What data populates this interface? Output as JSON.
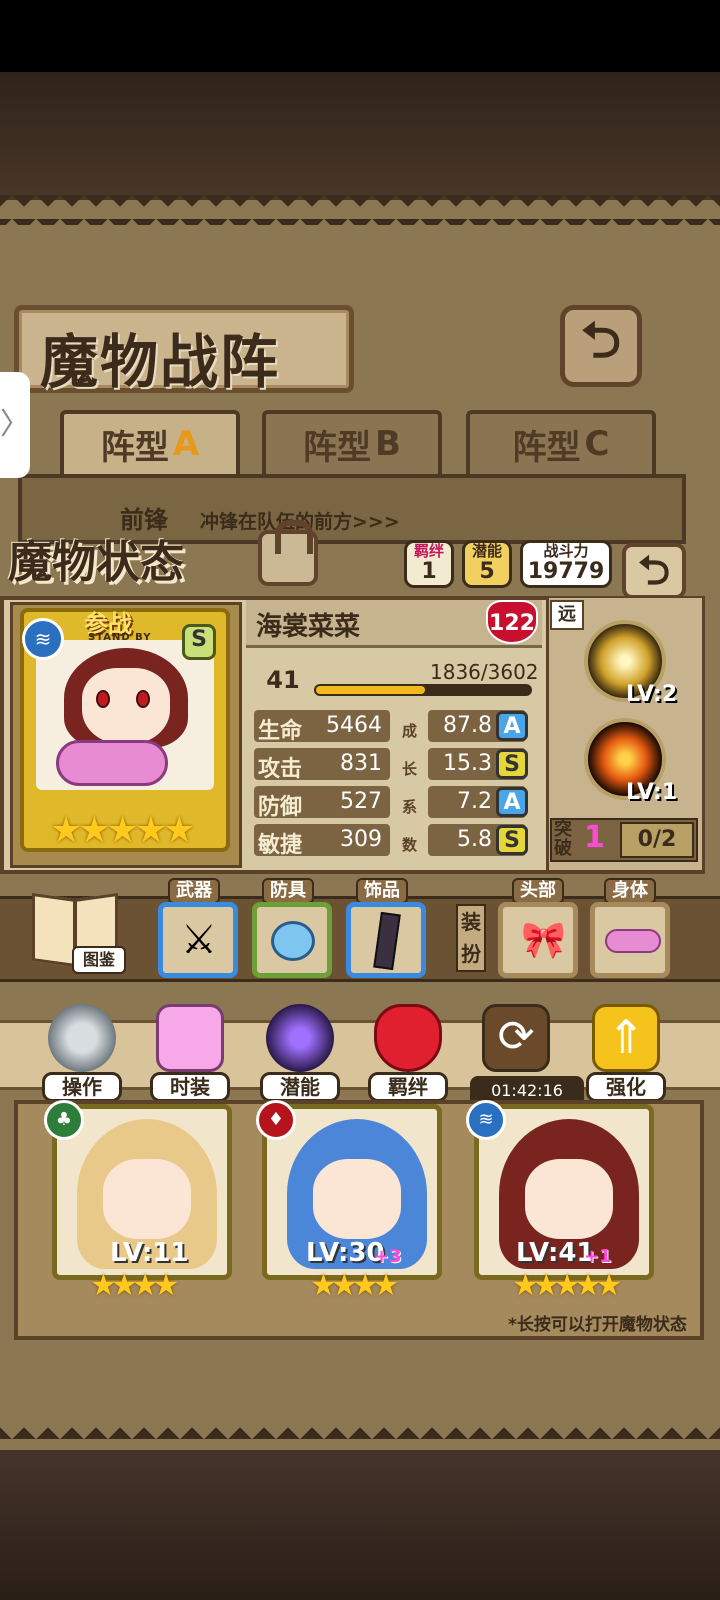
{
  "header": {
    "title": "魔物战阵",
    "back_icon": "back-arrow-icon"
  },
  "formation_tabs": [
    {
      "label": "阵型",
      "letter": "A"
    },
    {
      "label": "阵型",
      "letter": "B"
    },
    {
      "label": "阵型",
      "letter": "C"
    }
  ],
  "formation": {
    "position_label": "前锋",
    "position_desc": "冲锋在队伍的前方>>>"
  },
  "status": {
    "title": "魔物状态",
    "bond_label": "羁绊",
    "bond_value": "1",
    "potential_label": "潜能",
    "potential_value": "5",
    "power_label": "战斗力",
    "power_value": "19779"
  },
  "card": {
    "standby_label": "参战",
    "standby_sub": "STAND BY",
    "rank": "S",
    "stars": "★★★★★",
    "name": "海裳菜菜",
    "affection": "122",
    "level": "41",
    "exp_text": "1836/3602",
    "exp_progress": 0.51
  },
  "stats": [
    {
      "label": "生命",
      "value": "5464",
      "growth": "87.8",
      "grade": "A",
      "growth_char": "成"
    },
    {
      "label": "攻击",
      "value": "831",
      "growth": "15.3",
      "grade": "S",
      "growth_char": "长"
    },
    {
      "label": "防御",
      "value": "527",
      "growth": "7.2",
      "grade": "A",
      "growth_char": "系"
    },
    {
      "label": "敏捷",
      "value": "309",
      "growth": "5.8",
      "grade": "S",
      "growth_char": "数"
    }
  ],
  "range": {
    "label": "远"
  },
  "skills": [
    {
      "level": "LV:2"
    },
    {
      "level": "LV:1"
    }
  ],
  "break_through": {
    "label": "突破",
    "value": "1",
    "progress": "0/2"
  },
  "equipment": {
    "dex_label": "图鉴",
    "weapon_label": "武器",
    "armor_label": "防具",
    "accessory_label": "饰品",
    "outfit_label": "装扮",
    "head_label": "头部",
    "body_label": "身体"
  },
  "actions": [
    {
      "label": "操作",
      "icon": "gear-icon"
    },
    {
      "label": "时装",
      "icon": "outfit-icon"
    },
    {
      "label": "潜能",
      "icon": "potential-icon"
    },
    {
      "label": "羁绊",
      "icon": "bond-icon"
    },
    {
      "label": "",
      "icon": "swap-icon",
      "timer": "01:42:16"
    },
    {
      "label": "强化",
      "icon": "upgrade-icon"
    }
  ],
  "team": [
    {
      "level": "LV:11",
      "plus": "",
      "stars": "★★★★",
      "element": "leaf"
    },
    {
      "level": "LV:30",
      "plus": "+3",
      "stars": "★★★★",
      "element": "fire"
    },
    {
      "level": "LV:41",
      "plus": "+1",
      "stars": "★★★★★",
      "element": "water"
    }
  ],
  "hint": "*长按可以打开魔物状态",
  "colors": {
    "accent_gold": "#e0b92a",
    "break_pink": "#ff4ad8",
    "grade_A": "#4aa5e8",
    "grade_S": "#e5d63a"
  }
}
